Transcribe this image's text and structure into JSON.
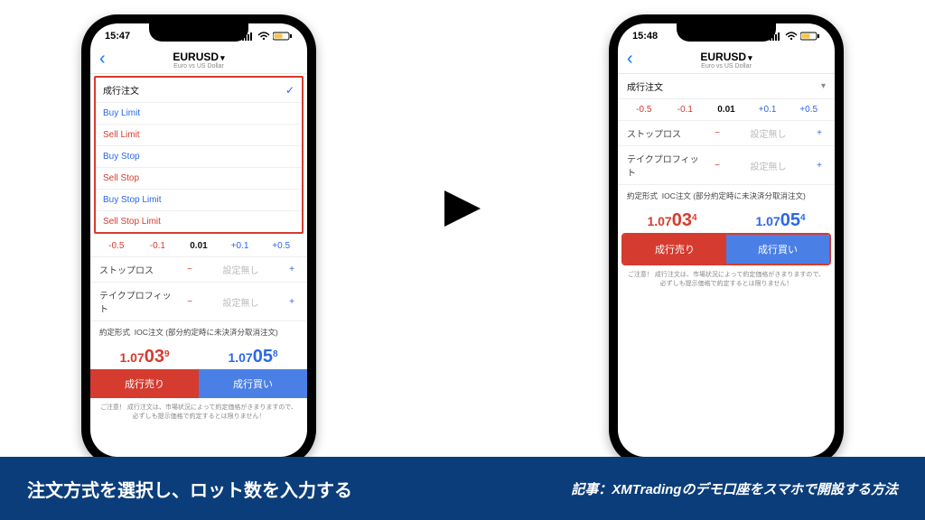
{
  "status": {
    "time_left": "15:47",
    "time_right": "15:48"
  },
  "header": {
    "symbol": "EURUSD",
    "desc": "Euro vs US Dollar"
  },
  "order_types": [
    {
      "label": "成行注文",
      "cls": "ot-plain",
      "selected": true
    },
    {
      "label": "Buy Limit",
      "cls": "ot-buy",
      "selected": false
    },
    {
      "label": "Sell Limit",
      "cls": "ot-sell",
      "selected": false
    },
    {
      "label": "Buy Stop",
      "cls": "ot-buy",
      "selected": false
    },
    {
      "label": "Sell Stop",
      "cls": "ot-sell",
      "selected": false
    },
    {
      "label": "Buy Stop Limit",
      "cls": "ot-buy",
      "selected": false
    },
    {
      "label": "Sell Stop Limit",
      "cls": "ot-sell",
      "selected": false
    }
  ],
  "selected_type_label": "成行注文",
  "lot_steps": {
    "n05": "-0.5",
    "n01": "-0.1",
    "val": "0.01",
    "p01": "+0.1",
    "p05": "+0.5"
  },
  "sl": {
    "label": "ストップロス",
    "placeholder": "設定無し"
  },
  "tp": {
    "label": "テイクプロフィット",
    "placeholder": "設定無し"
  },
  "exec": {
    "label": "約定形式",
    "value": "IOC注文 (部分約定時に未決済分取消注文)"
  },
  "price_left": {
    "sell_a": "1.07",
    "sell_b": "03",
    "sell_c": "9",
    "buy_a": "1.07",
    "buy_b": "05",
    "buy_c": "8"
  },
  "price_right": {
    "sell_a": "1.07",
    "sell_b": "03",
    "sell_c": "4",
    "buy_a": "1.07",
    "buy_b": "05",
    "buy_c": "4"
  },
  "btn": {
    "sell": "成行売り",
    "buy": "成行買い"
  },
  "warning": "ご注意！ 成行注文は、市場状況によって約定価格がきまりますので、必ずしも提示価格で約定するとは限りません！",
  "caption": {
    "left": "注文方式を選択し、ロット数を入力する",
    "right": "記事：XMTradingのデモ口座をスマホで開設する方法"
  }
}
